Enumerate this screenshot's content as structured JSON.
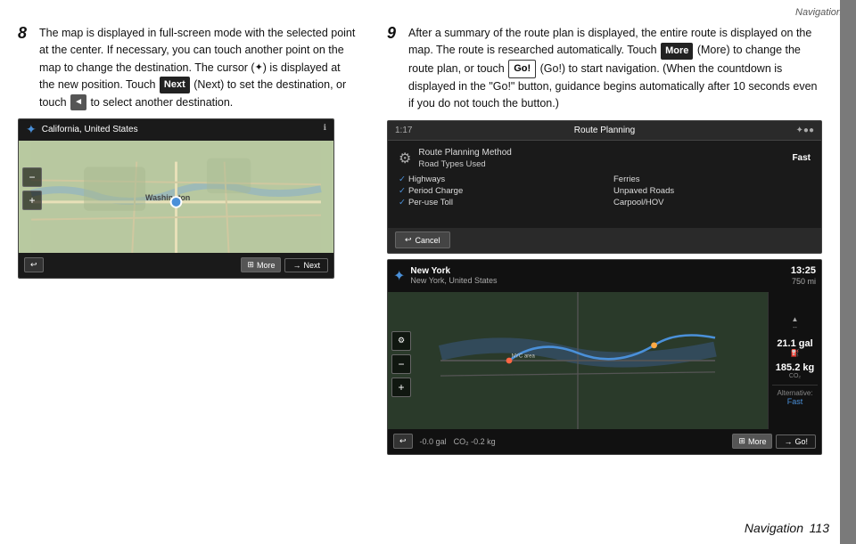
{
  "page": {
    "title": "Navigation",
    "footer": "Navigation",
    "page_number": "113"
  },
  "step8": {
    "number": "8",
    "text_parts": [
      "The map is displayed in full-screen mode with the selected point at the center. If necessary, you can touch another point on the map to change the destination. The cursor (",
      ") is displayed at the new position. Touch ",
      " (Next) to set the destination, or touch ",
      " to select another destination."
    ],
    "next_btn_label": "Next",
    "back_icon": "◄",
    "map": {
      "location_name": "Washington",
      "location_sub": "California, United States",
      "more_label": "More",
      "next_label": "Next"
    }
  },
  "step9": {
    "number": "9",
    "text_parts": [
      "After a summary of the route plan is displayed, the entire route is displayed on the map. The route is researched automatically. Touch ",
      " (More) to change the route plan, or touch ",
      " (Go!) to start navigation. (When the countdown is displayed in the \"Go!\" button, guidance begins automatically after 10 seconds even if you do not touch the button.)"
    ],
    "more_btn_label": "More",
    "go_btn_label": "Go!",
    "route_planning": {
      "title": "Route Planning",
      "time": "1:17",
      "icons": "✦●●",
      "method_label": "Route Planning Method",
      "method_value": "Fast",
      "road_types_label": "Road Types Used",
      "checks": [
        {
          "label": "Highways",
          "checked": true
        },
        {
          "label": "Ferries",
          "checked": false
        },
        {
          "label": "Period Charge",
          "checked": true
        },
        {
          "label": "Unpaved Roads",
          "checked": false
        },
        {
          "label": "Per-use Toll",
          "checked": true
        },
        {
          "label": "Carpool/HOV",
          "checked": false
        }
      ],
      "cancel_label": "Cancel"
    },
    "map_route": {
      "dest_name": "New York",
      "dest_sub": "New York, United States",
      "time": "13:25",
      "dist": "750 mi",
      "arrow_up": "▲",
      "fuel1_label": "21.1 gal",
      "fuel2_label": "185.2 kg",
      "fuel_icon1": "⛽",
      "fuel_icon2": "CO₂",
      "bottom_val1": "-0.0",
      "bottom_val2": "-0.2",
      "bottom_unit1": "gal",
      "bottom_unit2": "kg",
      "alternative_label": "Alternative:",
      "alternative_value": "Fast",
      "more_label": "More",
      "go_label": "Go!"
    }
  }
}
